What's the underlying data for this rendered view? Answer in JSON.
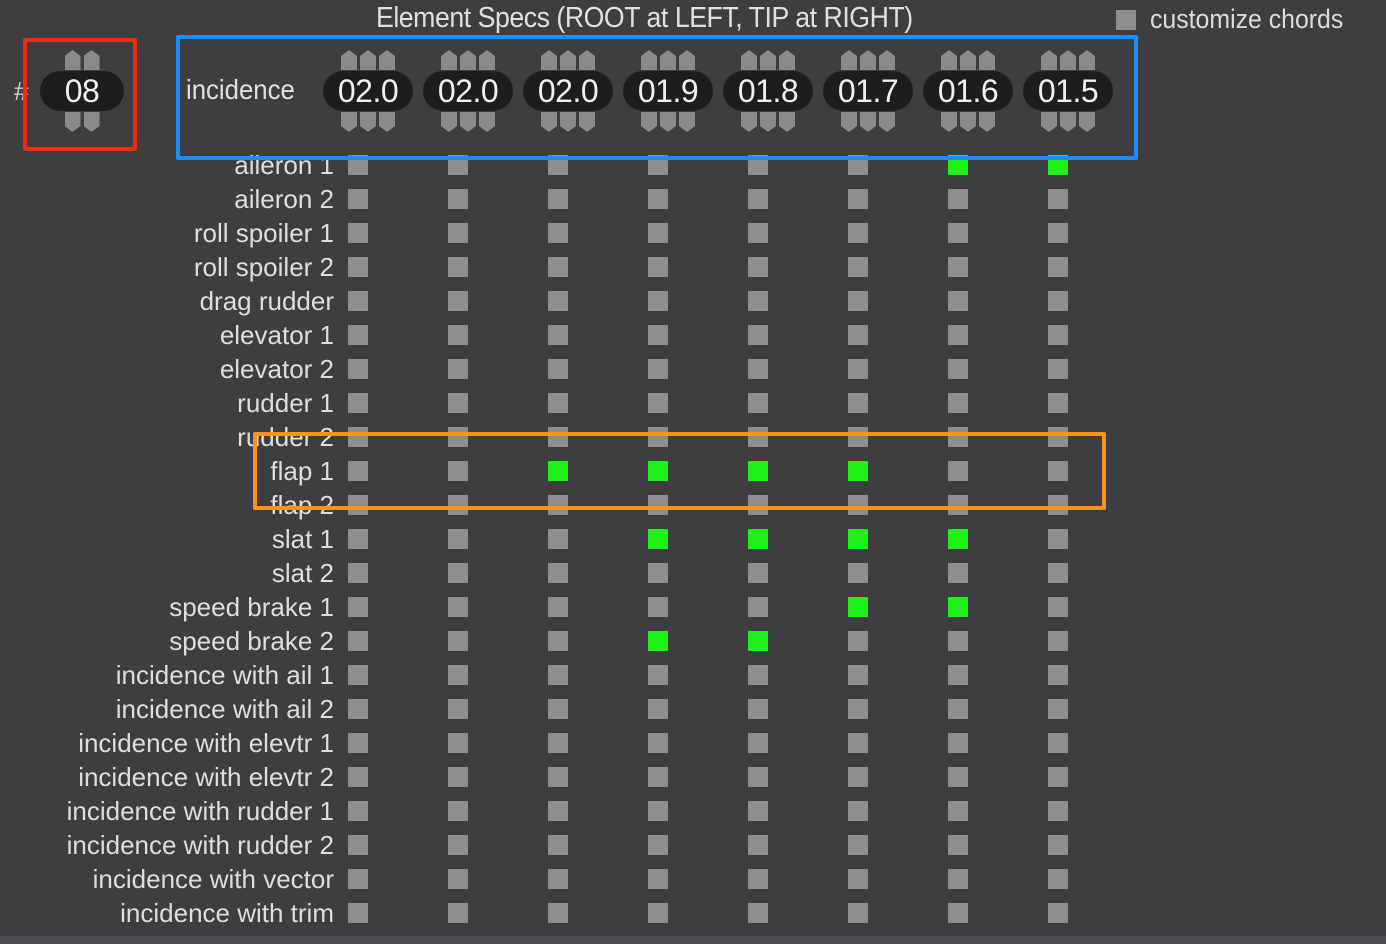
{
  "header": {
    "title": "Element Specs (ROOT at LEFT, TIP at RIGHT)",
    "customize_chords": {
      "label": "customize chords",
      "checked": false
    }
  },
  "element_count": {
    "prefix": "#",
    "value": "08"
  },
  "incidence": {
    "label": "incidence",
    "values": [
      "02.0",
      "02.0",
      "02.0",
      "01.9",
      "01.8",
      "01.7",
      "01.6",
      "01.5"
    ]
  },
  "colors": {
    "checked": "#1ff01a",
    "unchecked": "#8e8e8e",
    "background": "#3e3e40"
  },
  "rows": [
    {
      "label": "aileron 1",
      "checked": [
        false,
        false,
        false,
        false,
        false,
        false,
        true,
        true
      ]
    },
    {
      "label": "aileron 2",
      "checked": [
        false,
        false,
        false,
        false,
        false,
        false,
        false,
        false
      ]
    },
    {
      "label": "roll spoiler 1",
      "checked": [
        false,
        false,
        false,
        false,
        false,
        false,
        false,
        false
      ]
    },
    {
      "label": "roll spoiler 2",
      "checked": [
        false,
        false,
        false,
        false,
        false,
        false,
        false,
        false
      ]
    },
    {
      "label": "drag rudder",
      "checked": [
        false,
        false,
        false,
        false,
        false,
        false,
        false,
        false
      ]
    },
    {
      "label": "elevator 1",
      "checked": [
        false,
        false,
        false,
        false,
        false,
        false,
        false,
        false
      ]
    },
    {
      "label": "elevator 2",
      "checked": [
        false,
        false,
        false,
        false,
        false,
        false,
        false,
        false
      ]
    },
    {
      "label": "rudder 1",
      "checked": [
        false,
        false,
        false,
        false,
        false,
        false,
        false,
        false
      ]
    },
    {
      "label": "rudder 2",
      "checked": [
        false,
        false,
        false,
        false,
        false,
        false,
        false,
        false
      ]
    },
    {
      "label": "flap 1",
      "checked": [
        false,
        false,
        true,
        true,
        true,
        true,
        false,
        false
      ]
    },
    {
      "label": "flap 2",
      "checked": [
        false,
        false,
        false,
        false,
        false,
        false,
        false,
        false
      ]
    },
    {
      "label": "slat 1",
      "checked": [
        false,
        false,
        false,
        true,
        true,
        true,
        true,
        false
      ]
    },
    {
      "label": "slat 2",
      "checked": [
        false,
        false,
        false,
        false,
        false,
        false,
        false,
        false
      ]
    },
    {
      "label": "speed brake 1",
      "checked": [
        false,
        false,
        false,
        false,
        false,
        true,
        true,
        false
      ]
    },
    {
      "label": "speed brake 2",
      "checked": [
        false,
        false,
        false,
        true,
        true,
        false,
        false,
        false
      ]
    },
    {
      "label": "incidence with ail 1",
      "checked": [
        false,
        false,
        false,
        false,
        false,
        false,
        false,
        false
      ]
    },
    {
      "label": "incidence with ail 2",
      "checked": [
        false,
        false,
        false,
        false,
        false,
        false,
        false,
        false
      ]
    },
    {
      "label": "incidence with elevtr 1",
      "checked": [
        false,
        false,
        false,
        false,
        false,
        false,
        false,
        false
      ]
    },
    {
      "label": "incidence with elevtr 2",
      "checked": [
        false,
        false,
        false,
        false,
        false,
        false,
        false,
        false
      ]
    },
    {
      "label": "incidence with rudder 1",
      "checked": [
        false,
        false,
        false,
        false,
        false,
        false,
        false,
        false
      ]
    },
    {
      "label": "incidence with rudder 2",
      "checked": [
        false,
        false,
        false,
        false,
        false,
        false,
        false,
        false
      ]
    },
    {
      "label": "incidence with vector",
      "checked": [
        false,
        false,
        false,
        false,
        false,
        false,
        false,
        false
      ]
    },
    {
      "label": "incidence with trim",
      "checked": [
        false,
        false,
        false,
        false,
        false,
        false,
        false,
        false
      ]
    }
  ]
}
